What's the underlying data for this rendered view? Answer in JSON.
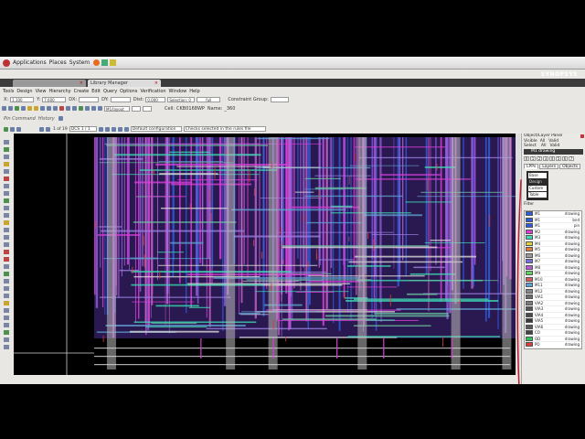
{
  "system_bar": {
    "applications": "Applications",
    "places": "Places",
    "system": "System"
  },
  "browser_tabs": [
    {
      "label": ""
    },
    {
      "label": "Library Manager"
    }
  ],
  "brand": "SYNOPSYS",
  "menu": [
    "Tools",
    "Design",
    "View",
    "Hierarchy",
    "Create",
    "Edit",
    "Query",
    "Options",
    "Verification",
    "Window",
    "Help"
  ],
  "toolbar1": {
    "x_label": "X:",
    "x_value": "1.100",
    "y_label": "Y:",
    "y_value": "7.600",
    "dx_label": "DX:",
    "dy_label": "DY:",
    "dist_label": "Dist:",
    "dist_value": "0.000",
    "selection_value": "Selection: 0",
    "full_value": "full",
    "constraint_label": "Constraint Group:"
  },
  "toolbar2": {
    "layer_value": "M1/layout",
    "cell_label": "Cell:",
    "cell_value": "CKB0168WP",
    "name_label": "Name:",
    "name_value": "_360"
  },
  "command": {
    "label": "Pin Command",
    "history": "History"
  },
  "toolbar3": {
    "page": "1 of 19",
    "net_value": "DCS 1 / 1",
    "config": "Default configuration",
    "filter": "Checks selected in the rules file"
  },
  "panel": {
    "title": "Object/Layer Panel",
    "visible_label": "Visible",
    "select_label": "Select",
    "all_label": "All",
    "valid_label": "Valid",
    "active_layer": "M1 drawing",
    "numtabs": [
      "0",
      "1",
      "2",
      "3",
      "4",
      "5",
      "6",
      "7"
    ],
    "subtabs": [
      "LPPs",
      "Layers",
      "Objects"
    ],
    "vis_options": [
      "Base",
      "Design",
      "Custom",
      "Table"
    ],
    "filter_label": "Filter",
    "layers": [
      {
        "name": "M1",
        "purpose": "drawing",
        "color": "#2f5bd6"
      },
      {
        "name": "M1",
        "purpose": "bnd",
        "color": "#2f5bd6"
      },
      {
        "name": "M1",
        "purpose": "pin",
        "color": "#2f5bd6"
      },
      {
        "name": "M2",
        "purpose": "drawing",
        "color": "#d63fd6"
      },
      {
        "name": "M3",
        "purpose": "drawing",
        "color": "#3fd6b0"
      },
      {
        "name": "M4",
        "purpose": "drawing",
        "color": "#e0d13a"
      },
      {
        "name": "M5",
        "purpose": "drawing",
        "color": "#e07a3a"
      },
      {
        "name": "M6",
        "purpose": "drawing",
        "color": "#9a9a9a"
      },
      {
        "name": "M7",
        "purpose": "drawing",
        "color": "#6f6fe0"
      },
      {
        "name": "M8",
        "purpose": "drawing",
        "color": "#b45ad6"
      },
      {
        "name": "M9",
        "purpose": "drawing",
        "color": "#5ad65a"
      },
      {
        "name": "M10",
        "purpose": "drawing",
        "color": "#d65a5a"
      },
      {
        "name": "M11",
        "purpose": "drawing",
        "color": "#5aa0d6"
      },
      {
        "name": "M12",
        "purpose": "drawing",
        "color": "#888888"
      },
      {
        "name": "VIA1",
        "purpose": "drawing",
        "color": "#6a6a6a"
      },
      {
        "name": "VIA2",
        "purpose": "drawing",
        "color": "#7a7a7a"
      },
      {
        "name": "VIA3",
        "purpose": "drawing",
        "color": "#555555"
      },
      {
        "name": "VIA4",
        "purpose": "drawing",
        "color": "#4a4a4a"
      },
      {
        "name": "VIA5",
        "purpose": "drawing",
        "color": "#3a3a3a"
      },
      {
        "name": "VIA6",
        "purpose": "drawing",
        "color": "#5a5a5a"
      },
      {
        "name": "CO",
        "purpose": "drawing",
        "color": "#444444"
      },
      {
        "name": "OD",
        "purpose": "drawing",
        "color": "#2ec25a"
      },
      {
        "name": "PO",
        "purpose": "drawing",
        "color": "#d63f3f"
      }
    ],
    "bottom_label": "M1 drawing"
  },
  "status": {
    "text": "",
    "right": ""
  },
  "colors": {
    "title_bar": "#6a4b9c",
    "canvas_bg": "#000000",
    "metal1": "#2f5bd6",
    "metal2": "#d63fd6",
    "metal3": "#3fd6b0",
    "poly": "#d63f3f",
    "annotation": "#c4172c"
  }
}
